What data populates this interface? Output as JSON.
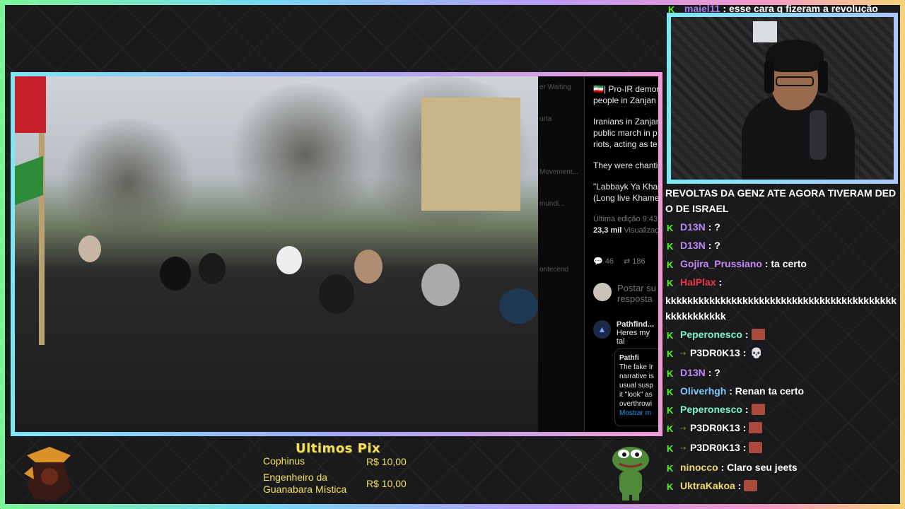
{
  "chat_top_cut": {
    "user": "maiel11",
    "text": ": esse cara q fizeram a revolução"
  },
  "tweet": {
    "line1": "🇮🇷| Pro-IR demor",
    "line2": "people in Zanjan",
    "para1a": "Iranians in Zanjan",
    "para1b": "public march in p",
    "para1c": "riots, acting as te",
    "para2": "They were chanti",
    "para3a": "\"Labbayk Ya Khan",
    "para3b": "(Long live Khame",
    "edit": "Última edição 9:43",
    "views": "23,3 mil",
    "views_label": "Visualizaç",
    "replies": "46",
    "retweets": "186",
    "reply_prompt_a": "Postar su",
    "reply_prompt_b": "resposta",
    "pf_name": "Pathfind...",
    "pf_text": "Heres my tal",
    "quote_name": "Pathfi",
    "quote_l1": "The fake Ir",
    "quote_l2": "narrative is",
    "quote_l3": "usual susp",
    "quote_l4": "it \"look\" as",
    "quote_l5": "overthrowi",
    "show_more": "Mostrar m",
    "left_strip": [
      "er Waiting",
      "urta",
      "Movement...",
      "mundi...",
      "ontecend"
    ]
  },
  "chat": {
    "messages": [
      {
        "user": "",
        "text": "REVOLTAS DA GENZ ATE AGORA TIVERAM DEDO DE ISRAEL",
        "user_color": "#ffffff",
        "badge": false,
        "wrap": true
      },
      {
        "user": "D13N",
        "text": ": ?",
        "user_color": "#b98af7",
        "badge": true
      },
      {
        "user": "D13N",
        "text": ": ?",
        "user_color": "#b98af7",
        "badge": true
      },
      {
        "user": "Gojira_Prussiano",
        "text": ": ta certo",
        "user_color": "#c58af7",
        "badge": true
      },
      {
        "user": "HalPlax",
        "text": ":",
        "user_color": "#e8354a",
        "badge": true
      },
      {
        "user": "",
        "text": "kkkkkkkkkkkkkkkkkkkkkkkkkkkkkkkkkkkkkkkkkkkkkkkkkkkkk",
        "user_color": "#ffffff",
        "badge": false,
        "wrap": true
      },
      {
        "user": "Peperonesco",
        "text": ":",
        "user_color": "#7df5c8",
        "badge": true,
        "emote": true
      },
      {
        "user": "P3DR0K13",
        "text": ":",
        "user_color": "#ffffff",
        "badge": true,
        "sub": true,
        "skull": true
      },
      {
        "user": "D13N",
        "text": ": ?",
        "user_color": "#b98af7",
        "badge": true
      },
      {
        "user": "Oliverhgh",
        "text": ": Renan ta certo",
        "user_color": "#7fc9f7",
        "badge": true
      },
      {
        "user": "Peperonesco",
        "text": ":",
        "user_color": "#7df5c8",
        "badge": true,
        "emote": true
      },
      {
        "user": "P3DR0K13",
        "text": ":",
        "user_color": "#ffffff",
        "badge": true,
        "sub": true,
        "emote": true
      },
      {
        "user": "P3DR0K13",
        "text": ":",
        "user_color": "#ffffff",
        "badge": true,
        "sub": true,
        "emote": true
      },
      {
        "user": "ninocco",
        "text": ": Claro seu jeets",
        "user_color": "#f2d96b",
        "badge": true
      },
      {
        "user": "UktraKakoa",
        "text": ":",
        "user_color": "#f2d96b",
        "badge": true,
        "emote": true
      }
    ]
  },
  "pix": {
    "title": "Ultimos Pix",
    "rows": [
      {
        "name": "Cophinus",
        "value": "R$ 10,00"
      },
      {
        "name": "Engenheiro da Guanabara Mística",
        "value": "R$ 10,00"
      }
    ]
  },
  "colors": {
    "accent_green": "#53fc18",
    "pix_yellow": "#f2e05a"
  },
  "icons": {
    "kick_badge": "kick-k-icon",
    "emote": "emote-icon",
    "skull": "skull-icon"
  }
}
